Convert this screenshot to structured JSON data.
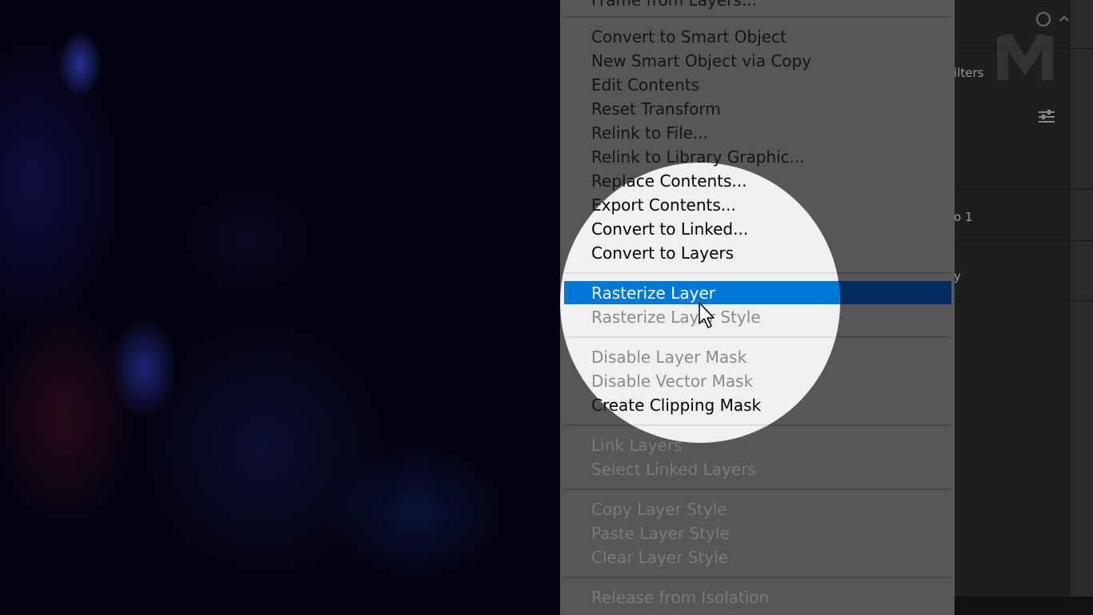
{
  "top_clipped_item": "Frame from Layers...",
  "context_menu": {
    "groups": [
      [
        {
          "label": "Convert to Smart Object",
          "enabled": true
        },
        {
          "label": "New Smart Object via Copy",
          "enabled": true
        },
        {
          "label": "Edit Contents",
          "enabled": true
        },
        {
          "label": "Reset Transform",
          "enabled": true
        },
        {
          "label": "Relink to File...",
          "enabled": true
        },
        {
          "label": "Relink to Library Graphic...",
          "enabled": true
        },
        {
          "label": "Replace Contents...",
          "enabled": true
        },
        {
          "label": "Export Contents...",
          "enabled": true
        },
        {
          "label": "Convert to Linked...",
          "enabled": true
        },
        {
          "label": "Convert to Layers",
          "enabled": true
        }
      ],
      [
        {
          "label": "Rasterize Layer",
          "enabled": true,
          "highlighted": true
        },
        {
          "label": "Rasterize Layer Style",
          "enabled": false
        }
      ],
      [
        {
          "label": "Disable Layer Mask",
          "enabled": false
        },
        {
          "label": "Disable Vector Mask",
          "enabled": false
        },
        {
          "label": "Create Clipping Mask",
          "enabled": true
        }
      ],
      [
        {
          "label": "Link Layers",
          "enabled": false
        },
        {
          "label": "Select Linked Layers",
          "enabled": false
        }
      ],
      [
        {
          "label": "Copy Layer Style",
          "enabled": false
        },
        {
          "label": "Paste Layer Style",
          "enabled": false
        },
        {
          "label": "Clear Layer Style",
          "enabled": false
        }
      ],
      [
        {
          "label": "Release from Isolation",
          "enabled": false
        }
      ]
    ]
  },
  "right_panel": {
    "filters_fragment": "ilters",
    "layer_name_fragment": "o 1",
    "row_fragment": "y"
  },
  "icons": {
    "search": "search-icon",
    "collapse": "chevron-up-icon",
    "filter": "filter-sliders-icon",
    "logo": "brand-logo",
    "cursor": "mouse-pointer-icon"
  },
  "colors": {
    "highlight": "#0078d7",
    "menu_bg": "#f0f0f0",
    "panel_bg": "#1e1e1e"
  }
}
